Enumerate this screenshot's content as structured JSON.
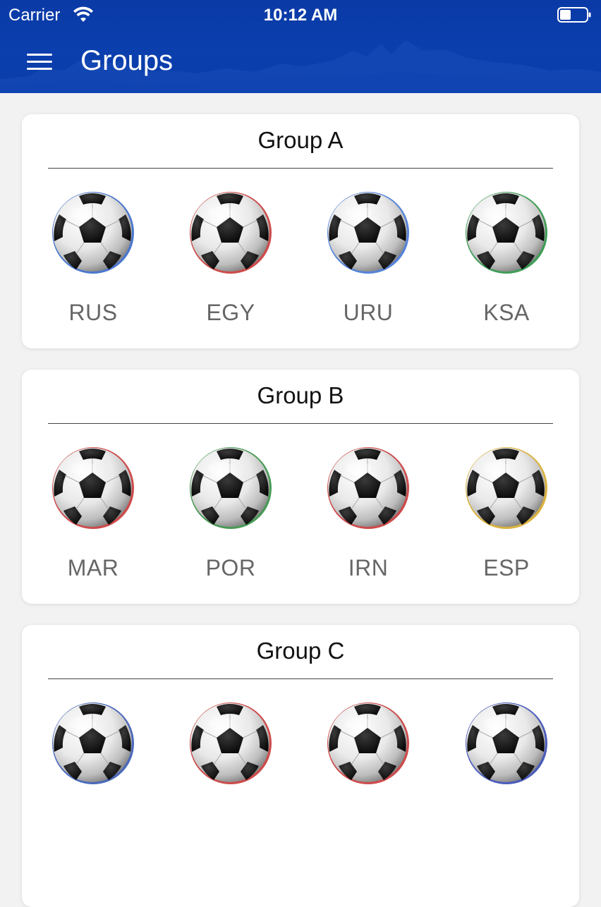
{
  "status_bar": {
    "carrier": "Carrier",
    "time": "10:12 AM"
  },
  "header": {
    "title": "Groups",
    "menu_icon": "hamburger-menu-icon"
  },
  "colors": {
    "header_blue": "#0a3ca8",
    "background": "#f2f2f2",
    "card": "#ffffff",
    "team_code_text": "#666666"
  },
  "groups": [
    {
      "title": "Group A",
      "teams": [
        {
          "code": "RUS",
          "accent": "#2b5fc4",
          "icon": "soccer-ball-icon"
        },
        {
          "code": "EGY",
          "accent": "#c42b2b",
          "icon": "soccer-ball-icon"
        },
        {
          "code": "URU",
          "accent": "#3a6fd1",
          "icon": "soccer-ball-icon"
        },
        {
          "code": "KSA",
          "accent": "#1e8c3a",
          "icon": "soccer-ball-icon"
        }
      ]
    },
    {
      "title": "Group B",
      "teams": [
        {
          "code": "MAR",
          "accent": "#c42b2b",
          "icon": "soccer-ball-icon"
        },
        {
          "code": "POR",
          "accent": "#2a8a3a",
          "icon": "soccer-ball-icon"
        },
        {
          "code": "IRN",
          "accent": "#c42b2b",
          "icon": "soccer-ball-icon"
        },
        {
          "code": "ESP",
          "accent": "#d4a41c",
          "icon": "soccer-ball-icon"
        }
      ]
    },
    {
      "title": "Group C",
      "teams": [
        {
          "code": "",
          "accent": "#2b4fb0",
          "icon": "soccer-ball-icon"
        },
        {
          "code": "",
          "accent": "#c42b2b",
          "icon": "soccer-ball-icon"
        },
        {
          "code": "",
          "accent": "#c42b2b",
          "icon": "soccer-ball-icon"
        },
        {
          "code": "",
          "accent": "#2b3fb0",
          "icon": "soccer-ball-icon"
        }
      ]
    }
  ]
}
